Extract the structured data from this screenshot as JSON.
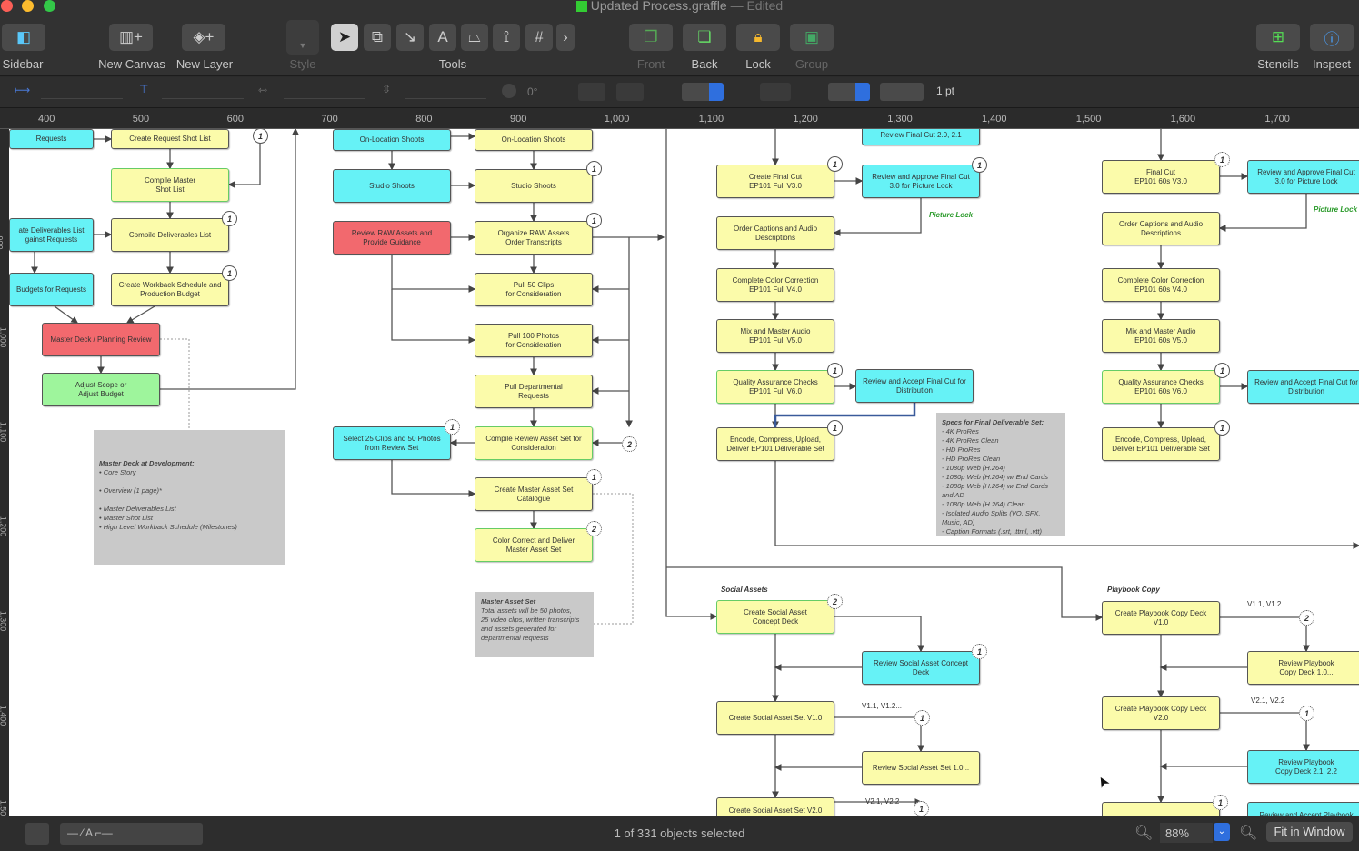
{
  "window": {
    "title": "Updated Process.graffle",
    "edited": "— Edited"
  },
  "toolbar": {
    "sidebar": "Sidebar",
    "new_canvas": "New Canvas",
    "new_layer": "New Layer",
    "style": "Style",
    "tools": "Tools",
    "front": "Front",
    "back": "Back",
    "lock": "Lock",
    "group": "Group",
    "stencils": "Stencils",
    "inspect": "Inspect"
  },
  "inspector_bar": {
    "rotation": "0°",
    "stroke_width": "1 pt"
  },
  "ruler": {
    "h": [
      "400",
      "500",
      "600",
      "700",
      "800",
      "900",
      "1,000",
      "1,100",
      "1,200",
      "1,300",
      "1,400",
      "1,500",
      "1,600",
      "1,700"
    ],
    "v": [
      "900",
      "1,000",
      "1,100",
      "1,200",
      "1,300",
      "1,400",
      "1,500"
    ]
  },
  "colors": {
    "cyan": "#66f2f6",
    "yellow": "#fbfbaa",
    "red": "#f2696e",
    "green": "#9ef59c",
    "note": "#c9c9c9",
    "picture_lock": "#2a9a2a"
  },
  "canvas": {
    "nodes": [
      {
        "text": "Requests",
        "fill": "cyan"
      },
      {
        "text": "Create Request Shot List",
        "fill": "yellow"
      },
      {
        "text": "Compile Master\nShot List",
        "fill": "yellow"
      },
      {
        "text": "ate Deliverables List\ngainst Requests",
        "fill": "cyan"
      },
      {
        "text": "Compile Deliverables List",
        "fill": "yellow"
      },
      {
        "text": "Budgets for Requests",
        "fill": "cyan"
      },
      {
        "text": "Create Workback Schedule and\nProduction Budget",
        "fill": "yellow"
      },
      {
        "text": "Master Deck / Planning Review",
        "fill": "red"
      },
      {
        "text": "Adjust Scope or\nAdjust Budget",
        "fill": "green"
      },
      {
        "text": "On-Location Shoots",
        "fill": "cyan"
      },
      {
        "text": "On-Location Shoots",
        "fill": "yellow"
      },
      {
        "text": "Studio Shoots",
        "fill": "cyan"
      },
      {
        "text": "Studio Shoots",
        "fill": "yellow"
      },
      {
        "text": "Review RAW Assets and\nProvide Guidance",
        "fill": "red"
      },
      {
        "text": "Organize RAW Assets\nOrder Transcripts",
        "fill": "yellow"
      },
      {
        "text": "Pull 50 Clips\nfor Consideration",
        "fill": "yellow"
      },
      {
        "text": "Pull 100 Photos\nfor Consideration",
        "fill": "yellow"
      },
      {
        "text": "Pull Departmental\nRequests",
        "fill": "yellow"
      },
      {
        "text": "Select 25 Clips and 50 Photos\nfrom Review Set",
        "fill": "cyan"
      },
      {
        "text": "Compile Review Asset Set for\nConsideration",
        "fill": "yellow"
      },
      {
        "text": "Create Master Asset Set\nCatalogue",
        "fill": "yellow"
      },
      {
        "text": "Color Correct and Deliver\nMaster Asset Set",
        "fill": "yellow"
      },
      {
        "text": "Review Final Cut 2.0, 2.1",
        "fill": "cyan"
      },
      {
        "text": "Create Final Cut\nEP101 Full V3.0",
        "fill": "yellow"
      },
      {
        "text": "Review and Approve Final Cut\n3.0 for Picture Lock",
        "fill": "cyan"
      },
      {
        "text": "Order Captions and Audio\nDescriptions",
        "fill": "yellow"
      },
      {
        "text": "Complete Color Correction\nEP101 Full V4.0",
        "fill": "yellow"
      },
      {
        "text": "Mix and Master Audio\nEP101 Full V5.0",
        "fill": "yellow"
      },
      {
        "text": "Quality Assurance Checks\nEP101 Full V6.0",
        "fill": "yellow"
      },
      {
        "text": "Review and Accept Final Cut for\nDistribution",
        "fill": "cyan"
      },
      {
        "text": "Encode, Compress, Upload,\nDeliver EP101 Deliverable Set",
        "fill": "yellow"
      },
      {
        "text": "Final Cut\nEP101 60s V3.0",
        "fill": "yellow"
      },
      {
        "text": "Review and Approve Final Cut\n3.0 for Picture Lock",
        "fill": "cyan"
      },
      {
        "text": "Order Captions and Audio\nDescriptions",
        "fill": "yellow"
      },
      {
        "text": "Complete Color Correction\nEP101 60s V4.0",
        "fill": "yellow"
      },
      {
        "text": "Mix and Master Audio\nEP101 60s V5.0",
        "fill": "yellow"
      },
      {
        "text": "Quality Assurance Checks\nEP101 60s V6.0",
        "fill": "yellow"
      },
      {
        "text": "Review and Accept Final Cut for\nDistribution",
        "fill": "cyan"
      },
      {
        "text": "Encode, Compress, Upload,\nDeliver EP101 Deliverable Set",
        "fill": "yellow"
      },
      {
        "text": "Create Social Asset\nConcept Deck",
        "fill": "yellow"
      },
      {
        "text": "Review Social Asset Concept\nDeck",
        "fill": "cyan"
      },
      {
        "text": "Create Social Asset Set V1.0",
        "fill": "yellow"
      },
      {
        "text": "Review Social Asset Set 1.0...",
        "fill": "yellow"
      },
      {
        "text": "Create Social Asset Set V2.0",
        "fill": "yellow"
      },
      {
        "text": "Create Playbook Copy Deck\nV1.0",
        "fill": "yellow"
      },
      {
        "text": "Review Playbook\nCopy Deck 1.0...",
        "fill": "yellow"
      },
      {
        "text": "Create Playbook Copy Deck\nV2.0",
        "fill": "yellow"
      },
      {
        "text": "Review Playbook\nCopy Deck 2.1, 2.2",
        "fill": "cyan"
      },
      {
        "text": "",
        "fill": "yellow"
      },
      {
        "text": "Review and Accept Playbook",
        "fill": "cyan"
      }
    ],
    "notes": [
      {
        "title": "Master Deck at Development:",
        "body": "• Core Story\n\n• Overview (1 page)*\n\n• Master Deliverables List\n• Master Shot List\n• High Level Workback Schedule (Milestones)"
      },
      {
        "title": "Master Asset Set",
        "body": "Total assets will be 50 photos,\n25 video clips, written transcripts\nand assets generated for\ndepartmental requests"
      },
      {
        "title": "Specs for Final Deliverable Set:",
        "body": "- 4K ProRes\n- 4K ProRes Clean\n- HD ProRes\n- HD ProRes Clean\n- 1080p Web (H.264)\n- 1080p Web (H.264) w/ End Cards\n- 1080p Web (H.264) w/ End Cards and AD\n- 1080p Web (H.264) Clean\n- Isolated Audio Splits (VO, SFX, Music, AD)\n- Caption Formats (.srt, .ttml, .vtt)"
      }
    ],
    "labels": [
      "Picture Lock",
      "Picture Lock",
      "Social Assets",
      "Playbook Copy",
      "V1.1, V1.2...",
      "V2.1, V2.2",
      "V1.1, V1.2...",
      "V2.1, V2.2"
    ],
    "badges": [
      "1",
      "1",
      "1",
      "1",
      "1",
      "1",
      "2",
      "1",
      "2",
      "1",
      "1",
      "1",
      "1",
      "1",
      "1",
      "1",
      "2",
      "1",
      "1",
      "1",
      "2",
      "1",
      "1"
    ]
  },
  "status": {
    "selection": "1 of 331 objects selected",
    "zoom": "88%",
    "fit": "Fit in Window"
  }
}
